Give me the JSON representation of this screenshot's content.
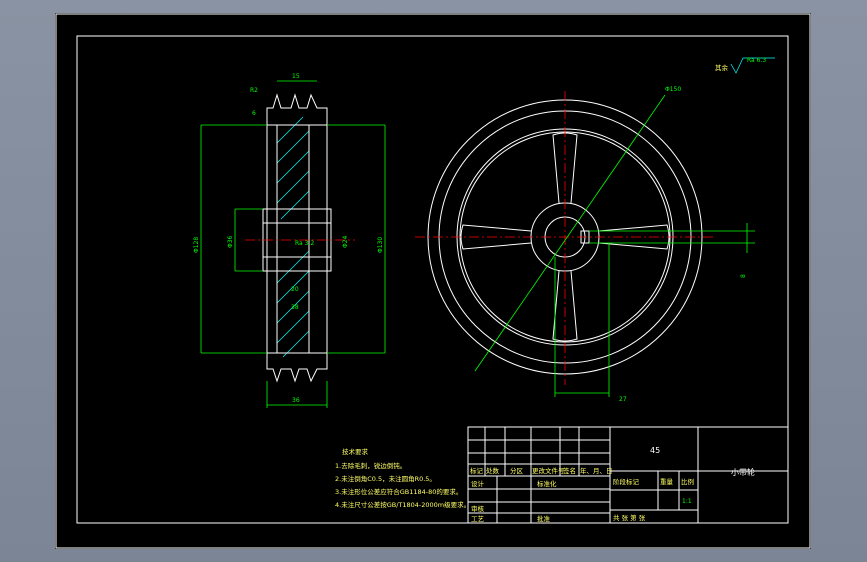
{
  "drawing": {
    "title": "小带轮",
    "material": "45",
    "scale": "1:1"
  },
  "surface_note": {
    "label": "其余",
    "roughness": "Ra 6.3"
  },
  "section_view": {
    "dims": {
      "groove_top": "15",
      "top_a": "R2",
      "top_b": "6",
      "dia_left": "Φ128",
      "dia_hub": "Φ36",
      "roughness": "Ra 3.2",
      "bore": "Φ24",
      "dia_outer": "Φ130",
      "web_a": "20",
      "web_b": "38",
      "width": "36"
    }
  },
  "front_view": {
    "dims": {
      "leader": "Φ150",
      "keyway_depth": "27",
      "keyway_width": "8"
    }
  },
  "tech_requirements": {
    "title": "技术要求",
    "items": [
      "1.去除毛刺，锐边倒钝。",
      "2.未注倒角C0.5，未注圆角R0.5。",
      "3.未注形位公差应符合GB1184-80的要求。",
      "4.未注尺寸公差按GB/T1804-2000m级要求。"
    ]
  },
  "title_block": {
    "row_marks": "标记",
    "row_count": "处数",
    "row_zone": "分区",
    "row_doc": "更改文件号",
    "row_sign": "签名",
    "row_date": "年、月、日",
    "design": "设计",
    "standard": "标准化",
    "stage_mark": "阶段标记",
    "weight": "重量",
    "scale_label": "比例",
    "review": "审核",
    "process": "工艺",
    "approve": "批准",
    "sheets": "共   张   第   张"
  }
}
